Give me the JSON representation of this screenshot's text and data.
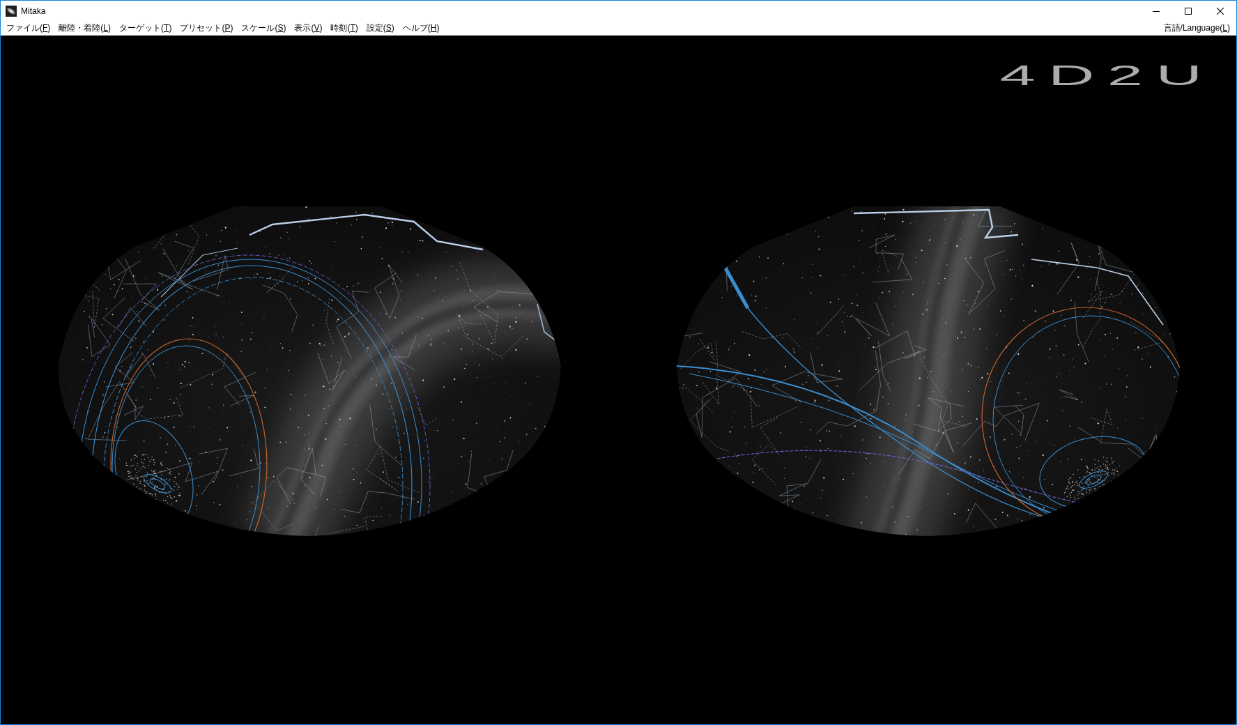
{
  "window": {
    "title": "Mitaka",
    "controls": [
      {
        "kind": "minimize"
      },
      {
        "kind": "maximize"
      },
      {
        "kind": "close"
      }
    ]
  },
  "menu_bar": {
    "items": [
      {
        "label": "ファイル(F)",
        "access_key_underlined": true
      },
      {
        "label": "離陸・着陸(L)",
        "access_key_underlined": true
      },
      {
        "label": "ターゲット(T)",
        "access_key_underlined": true
      },
      {
        "label": "プリセット(P)",
        "access_key_underlined": true
      },
      {
        "label": "スケール(S)",
        "access_key_underlined": true
      },
      {
        "label": "表示(V)",
        "access_key_underlined": true
      },
      {
        "label": "時刻(T)",
        "access_key_underlined": true
      },
      {
        "label": "設定(S)",
        "access_key_underlined": true
      },
      {
        "label": "ヘルプ(H)",
        "access_key_underlined": true
      }
    ],
    "right_items": [
      {
        "label": "言語/Language(L)",
        "access_key_underlined": true
      }
    ]
  },
  "view": {
    "logo": "4D2U"
  }
}
